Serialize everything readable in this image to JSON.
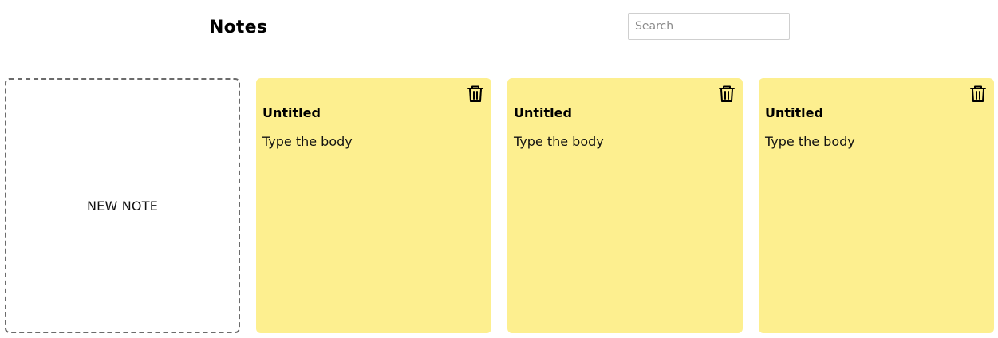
{
  "header": {
    "title": "Notes"
  },
  "search": {
    "placeholder": "Search",
    "value": ""
  },
  "new_note": {
    "label": "NEW NOTE"
  },
  "notes": [
    {
      "title": "Untitled",
      "body": "Type the body",
      "delete_icon": "trash-icon"
    },
    {
      "title": "Untitled",
      "body": "Type the body",
      "delete_icon": "trash-icon"
    },
    {
      "title": "Untitled",
      "body": "Type the body",
      "delete_icon": "trash-icon"
    }
  ],
  "colors": {
    "note_background": "#fdef8f",
    "new_note_border": "#6b6b6b",
    "icon": "#000000"
  }
}
